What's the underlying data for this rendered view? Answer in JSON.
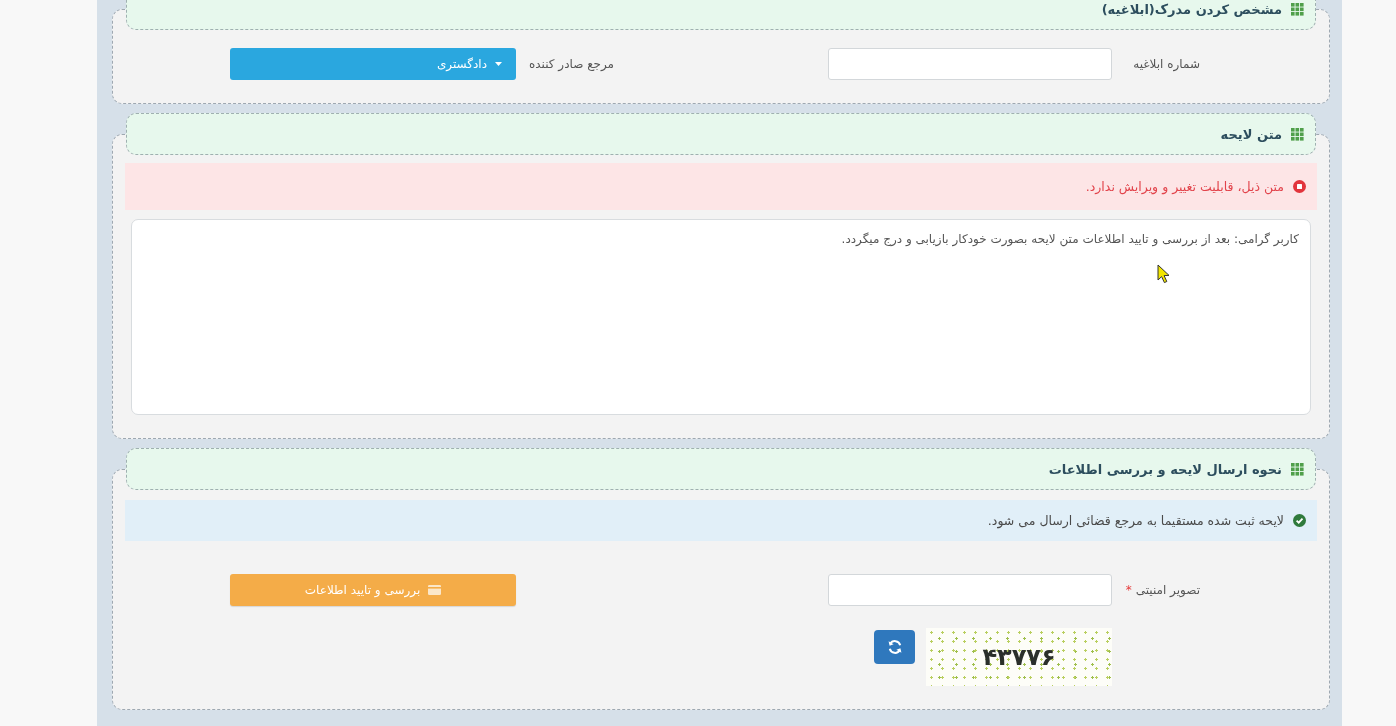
{
  "sections": [
    {
      "title": "مشخص کردن مدرک(ابلاغیه)",
      "fields": [
        {
          "kind": "input",
          "label": "شماره ابلاغیه"
        },
        {
          "kind": "dropdown",
          "label": "مرجع صادر کننده",
          "value": "دادگستری"
        }
      ]
    },
    {
      "title": "متن لایحه",
      "alert": {
        "kind": "danger",
        "text": "متن ذیل، قابلیت تغییر و ویرایش ندارد."
      },
      "textarea": {
        "value": "کاربر گرامی: بعد از بررسی و تایید اطلاعات متن لایحه بصورت خودکار بازیابی و درج میگردد."
      }
    },
    {
      "title": "نحوه ارسال لایحه و بررسی اطلاعات",
      "alert": {
        "kind": "success",
        "text": "لایحه ثبت شده مستقیما به مرجع قضائی ارسال می شود."
      },
      "fields": [
        {
          "kind": "input",
          "label": "تصویر امنیتی",
          "required_mark": "*"
        },
        {
          "kind": "button",
          "label": "بررسی و تایید اطلاعات"
        }
      ],
      "captcha": {
        "code": "۴۳۷۷۶"
      }
    }
  ]
}
